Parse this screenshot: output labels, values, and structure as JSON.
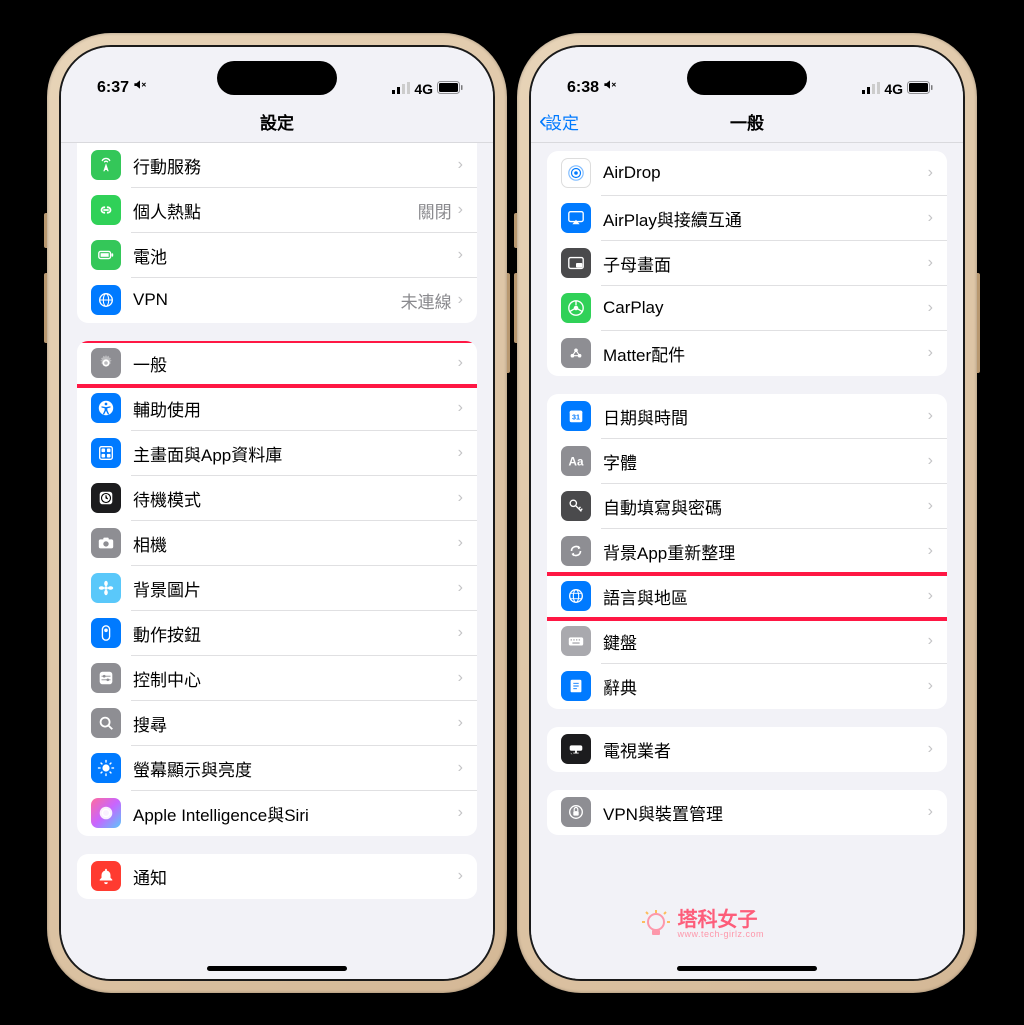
{
  "watermark": {
    "main": "塔科女子",
    "sub": "www.tech-girlz.com"
  },
  "left": {
    "status": {
      "time": "6:37",
      "network": "4G",
      "signal": "●●●○",
      "silent_icon": "silent"
    },
    "nav": {
      "title": "設定"
    },
    "groups": [
      {
        "first": true,
        "rows": [
          {
            "icon": "antenna",
            "bg": "bg-green",
            "label": "行動服務",
            "detail": ""
          },
          {
            "icon": "link",
            "bg": "bg-green2",
            "label": "個人熱點",
            "detail": "關閉"
          },
          {
            "icon": "battery",
            "bg": "bg-green",
            "label": "電池",
            "detail": ""
          },
          {
            "icon": "globe",
            "bg": "bg-blue",
            "label": "VPN",
            "detail": "未連線"
          }
        ]
      },
      {
        "rows": [
          {
            "icon": "gear",
            "bg": "bg-gray",
            "label": "一般",
            "detail": "",
            "highlight": true
          },
          {
            "icon": "accessibility",
            "bg": "bg-blue",
            "label": "輔助使用",
            "detail": ""
          },
          {
            "icon": "apps",
            "bg": "bg-blue",
            "label": "主畫面與App資料庫",
            "detail": ""
          },
          {
            "icon": "clock",
            "bg": "bg-black",
            "label": "待機模式",
            "detail": ""
          },
          {
            "icon": "camera",
            "bg": "bg-gray",
            "label": "相機",
            "detail": ""
          },
          {
            "icon": "flower",
            "bg": "bg-teal",
            "label": "背景圖片",
            "detail": ""
          },
          {
            "icon": "action",
            "bg": "bg-blue",
            "label": "動作按鈕",
            "detail": ""
          },
          {
            "icon": "sliders",
            "bg": "bg-gray",
            "label": "控制中心",
            "detail": ""
          },
          {
            "icon": "search",
            "bg": "bg-gray",
            "label": "搜尋",
            "detail": ""
          },
          {
            "icon": "brightness",
            "bg": "bg-blue",
            "label": "螢幕顯示與亮度",
            "detail": ""
          },
          {
            "icon": "siri",
            "bg": "bg-gradient",
            "label": "Apple Intelligence與Siri",
            "detail": ""
          }
        ]
      },
      {
        "rows": [
          {
            "icon": "bell",
            "bg": "bg-red",
            "label": "通知",
            "detail": ""
          }
        ]
      }
    ]
  },
  "right": {
    "status": {
      "time": "6:38",
      "network": "4G",
      "signal": "●●●○",
      "silent_icon": "silent"
    },
    "nav": {
      "back": "設定",
      "title": "一般"
    },
    "groups": [
      {
        "tight": true,
        "rows": [
          {
            "icon": "airdrop",
            "bg": "bg-white-border",
            "label": "AirDrop",
            "detail": ""
          },
          {
            "icon": "airplay",
            "bg": "bg-blue",
            "label": "AirPlay與接續互通",
            "detail": ""
          },
          {
            "icon": "pip",
            "bg": "bg-darkgray",
            "label": "子母畫面",
            "detail": ""
          },
          {
            "icon": "carplay",
            "bg": "bg-green2",
            "label": "CarPlay",
            "detail": ""
          },
          {
            "icon": "matter",
            "bg": "bg-gray",
            "label": "Matter配件",
            "detail": ""
          }
        ]
      },
      {
        "rows": [
          {
            "icon": "calendar",
            "bg": "bg-blue",
            "label": "日期與時間",
            "detail": ""
          },
          {
            "icon": "font",
            "bg": "bg-gray",
            "label": "字體",
            "detail": ""
          },
          {
            "icon": "key",
            "bg": "bg-darkgray",
            "label": "自動填寫與密碼",
            "detail": ""
          },
          {
            "icon": "refresh",
            "bg": "bg-gray",
            "label": "背景App重新整理",
            "detail": ""
          },
          {
            "icon": "globe2",
            "bg": "bg-blue",
            "label": "語言與地區",
            "detail": "",
            "highlight": true
          },
          {
            "icon": "keyboard",
            "bg": "bg-graylight",
            "label": "鍵盤",
            "detail": ""
          },
          {
            "icon": "book",
            "bg": "bg-blue",
            "label": "辭典",
            "detail": ""
          }
        ]
      },
      {
        "rows": [
          {
            "icon": "tv",
            "bg": "bg-black",
            "label": "電視業者",
            "detail": ""
          }
        ]
      },
      {
        "rows": [
          {
            "icon": "vpn",
            "bg": "bg-gray",
            "label": "VPN與裝置管理",
            "detail": ""
          }
        ]
      }
    ]
  }
}
